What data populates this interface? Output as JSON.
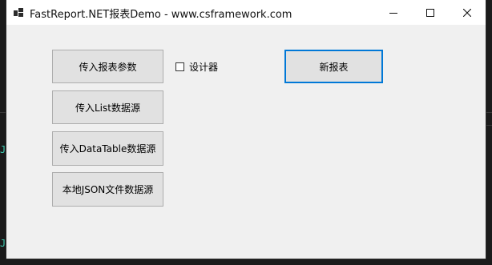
{
  "window": {
    "title": "FastReport.NET报表Demo - www.csframework.com"
  },
  "titlebar": {
    "minimize_icon": "minimize-icon",
    "maximize_icon": "maximize-icon",
    "close_icon": "close-icon"
  },
  "buttons": {
    "report_params": "传入报表参数",
    "list_source": "传入List数据源",
    "datatable_source": "传入DataTable数据源",
    "local_json": "本地JSON文件数据源",
    "new_report": "新报表"
  },
  "designer_checkbox": {
    "label": "设计器",
    "checked": false
  },
  "colors": {
    "accent": "#0078d7",
    "button_bg": "#e1e1e1",
    "window_bg": "#f0f0f0"
  }
}
